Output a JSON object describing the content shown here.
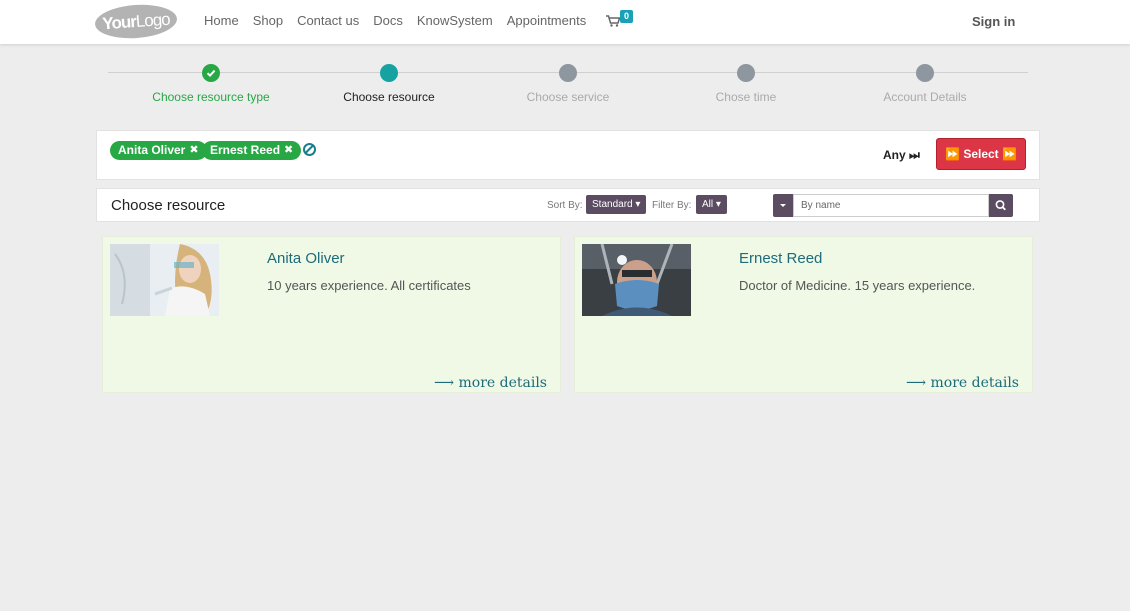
{
  "header": {
    "logo": {
      "part1": "Your",
      "part2": "Logo"
    },
    "nav": [
      "Home",
      "Shop",
      "Contact us",
      "Docs",
      "KnowSystem",
      "Appointments"
    ],
    "cart_count": "0",
    "signin": "Sign in"
  },
  "steps": [
    {
      "label": "Choose resource type",
      "state": "done"
    },
    {
      "label": "Choose resource",
      "state": "active"
    },
    {
      "label": "Choose service",
      "state": "pending"
    },
    {
      "label": "Chose time",
      "state": "pending"
    },
    {
      "label": "Account Details",
      "state": "pending"
    }
  ],
  "selection": {
    "tags": [
      "Anita Oliver",
      "Ernest Reed"
    ],
    "any_label": "Any",
    "select_label": "Select"
  },
  "choose_bar": {
    "title": "Choose resource",
    "sort_label": "Sort By:",
    "sort_value": "Standard",
    "filter_label": "Filter By:",
    "filter_value": "All",
    "search_placeholder": "By name"
  },
  "resources": [
    {
      "name": "Anita Oliver",
      "description": "10 years experience. All certificates",
      "more": "more details",
      "photo_icon": "dentist-photo"
    },
    {
      "name": "Ernest Reed",
      "description": "Doctor of Medicine. 15 years experience.",
      "more": "more details",
      "photo_icon": "surgeon-photo"
    }
  ],
  "colors": {
    "success": "#28a745",
    "accent": "#17a2a2",
    "danger": "#dc3545",
    "dropdown": "#5b4c62",
    "card_bg": "#f0f8e6",
    "link": "#1d6c7a"
  }
}
